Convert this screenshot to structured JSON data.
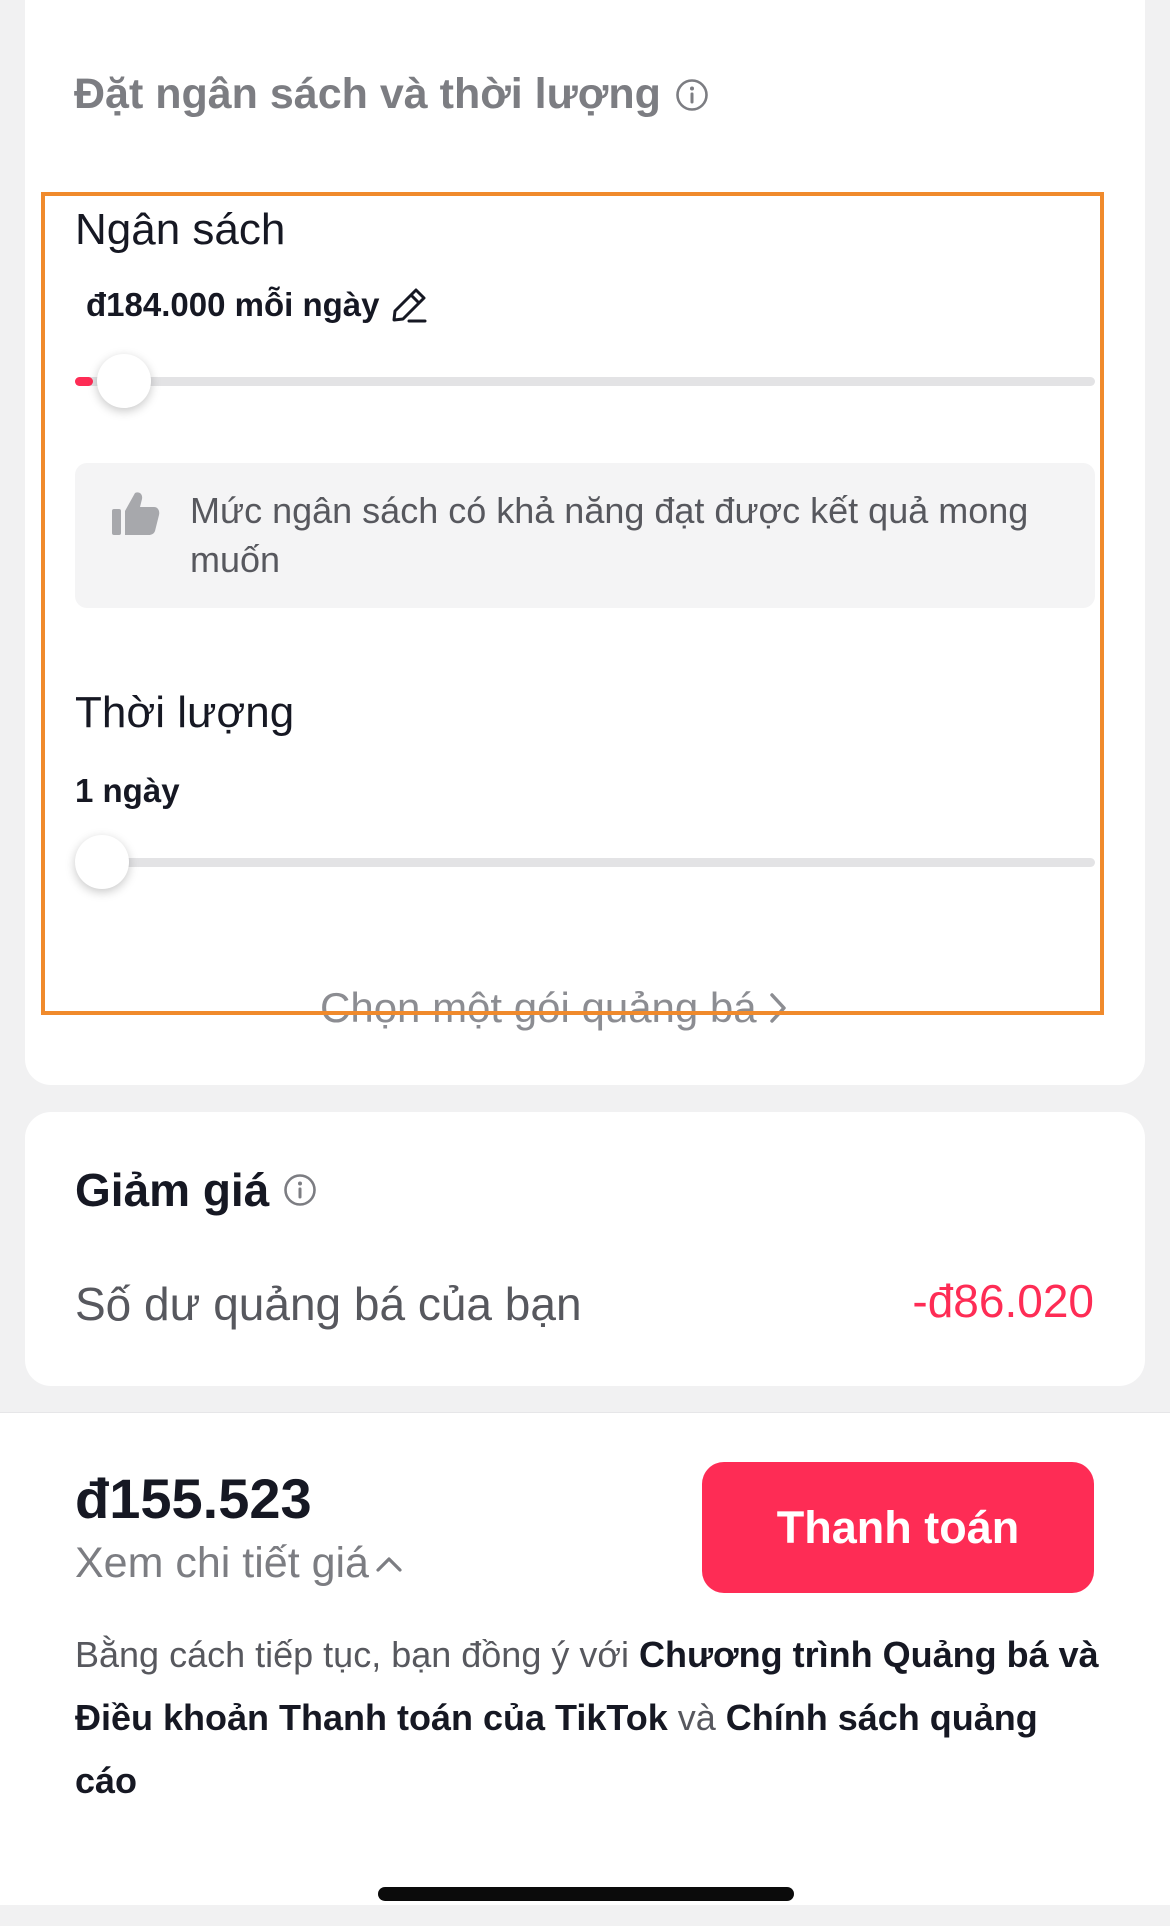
{
  "budget_section": {
    "title": "Đặt ngân sách và thời lượng",
    "budget_label": "Ngân sách",
    "budget_value": "đ184.000 mỗi ngày",
    "budget_slider_fraction": 0.01,
    "hint_text": "Mức ngân sách có khả năng đạt được kết quả mong muốn",
    "duration_label": "Thời lượng",
    "duration_value": "1 ngày",
    "duration_slider_fraction": 0.0,
    "package_link": "Chọn một gói quảng bá"
  },
  "discount": {
    "title": "Giảm giá",
    "balance_label": "Số dư quảng bá của bạn",
    "balance_value": "-đ86.020"
  },
  "checkout": {
    "total": "đ155.523",
    "detail_link": "Xem chi tiết giá",
    "pay_button": "Thanh toán",
    "terms_prefix": "Bằng cách tiếp tục, bạn đồng ý với ",
    "terms_link_1": "Chương trình Quảng bá và Điều khoản Thanh toán của TikTok",
    "terms_middle": " và ",
    "terms_link_2": "Chính sách quảng cáo"
  },
  "colors": {
    "accent": "#fe2c55",
    "highlight_border": "#f08a2c",
    "page_background": "#f1f1f2"
  },
  "icons": {
    "info": "info-circle-icon",
    "edit": "pencil-icon",
    "hint": "thumbs-up-icon",
    "chevron_right": "chevron-right-icon",
    "chevron_up": "chevron-up-icon"
  }
}
